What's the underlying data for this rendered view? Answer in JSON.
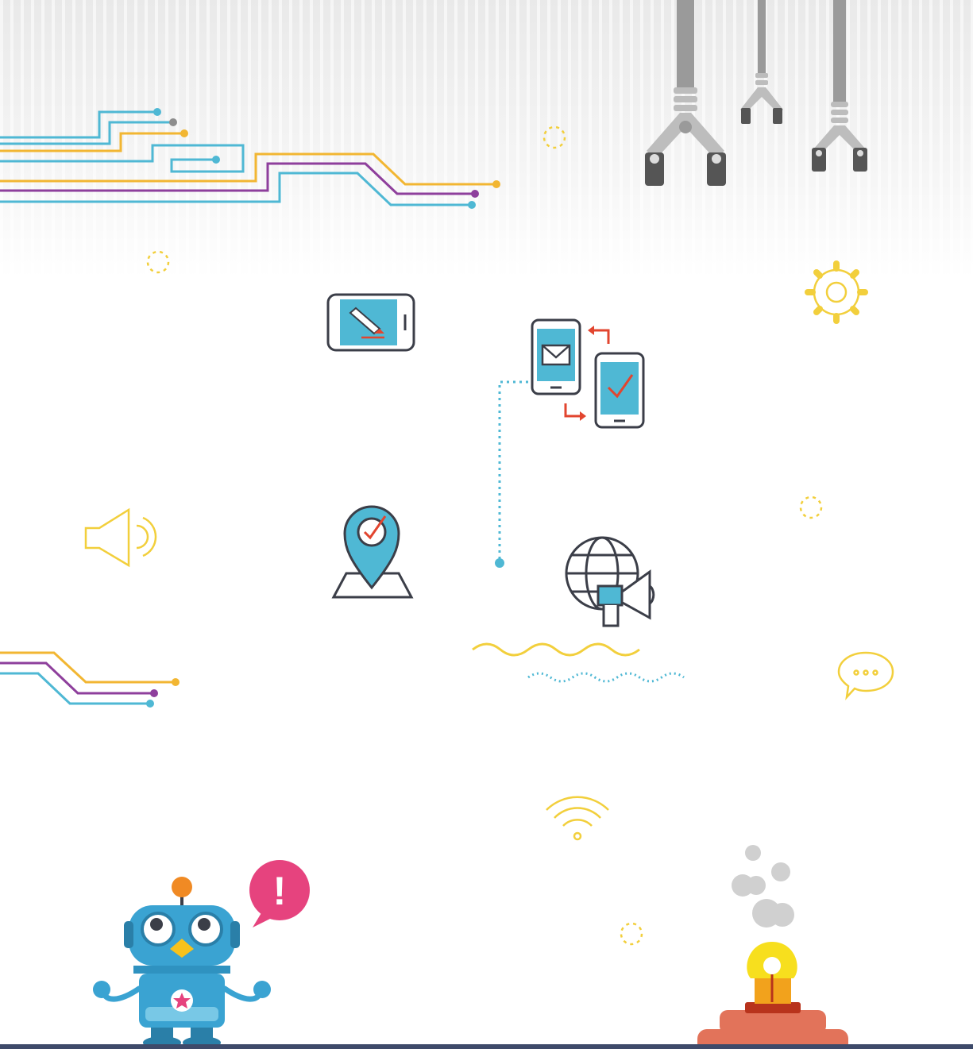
{
  "colors": {
    "yellow": "#f2b632",
    "purple": "#8e3f9c",
    "cyan": "#4fb8d4",
    "gray": "#8d8d8d",
    "dark": "#3b3e48",
    "red": "#e2452f",
    "pink": "#e6437e",
    "orange": "#f08a24",
    "robot_blue": "#3aa3d2",
    "bulb_yellow": "#f7df1e",
    "base_salmon": "#e2735a",
    "accent_outline": "#f2cf3c",
    "floor": "#3e4a6a"
  },
  "scene": {
    "icons": [
      "circuit-lines-top",
      "robot-claws",
      "sparkle-icons",
      "gear-icon",
      "phone-edit-icon",
      "phones-sync-icon",
      "location-pin-icon",
      "globe-megaphone-icon",
      "speaker-icon",
      "chat-bubble-icon",
      "wifi-icon",
      "robot-mascot",
      "alert-bubble-icon",
      "lightbulb-button"
    ],
    "alert_symbol": "!"
  }
}
